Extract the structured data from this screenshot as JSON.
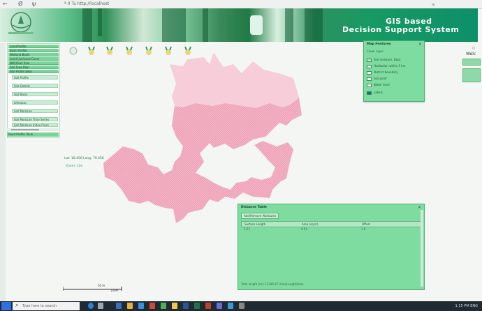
{
  "browser": {
    "url_text": "ª 0 Tu http://localhost",
    "right_text": "ক",
    "nav_back": "←",
    "nav_icons": [
      "Ø",
      "ψ"
    ]
  },
  "header": {
    "title_line1": "GIS based",
    "title_line2": "Decision Support System"
  },
  "sidebar": {
    "items": [
      "Land Profile",
      "Basin Profile",
      "Wetland Basin",
      "Land Use/Land Cover",
      "NDVI/Soil Rain",
      "Soil Type Rain",
      "Soil Profile Sites"
    ],
    "subitems": [
      "Soil Profile",
      "Site Details",
      "Soil Basin",
      "Lithology",
      "Soil Moisture",
      "Soil Moisture Time Series",
      "Soil Moisture Index Class"
    ],
    "bottom_item": "Road Profile Taluk"
  },
  "legend": {
    "title": "Map Features",
    "subtitle": "Cover Layer",
    "rows": [
      {
        "label": "Soil moisture, Dept",
        "color": "#b9e6c6"
      },
      {
        "label": "Habitation within 5 km",
        "color": "#d9f1df"
      },
      {
        "label": "District boundary",
        "color": "#ffffff"
      },
      {
        "label": "Soil point",
        "color": "#eaf7ee"
      },
      {
        "label": "Water level",
        "color": "#ffffff"
      },
      {
        "label": "Labels",
        "color": "#1b6e73"
      }
    ]
  },
  "right": {
    "welcome": "Welc",
    "dot": "○"
  },
  "map": {
    "latlong": "Lat: 18.456 Long: 79.456",
    "zoom": "Zoom: 10x",
    "scale_top": "50 m",
    "scale_bottom": "100m"
  },
  "panel": {
    "title": "Distance Table",
    "button": "Add/Remove Attributes",
    "headers": [
      "Surface Length",
      "Area (sq.m)",
      "Offset"
    ],
    "row": [
      "1.21",
      "0.54",
      "1.0"
    ],
    "footer": "Total length (m): 12345.67 Area/Length/Area"
  },
  "taskbar": {
    "search_placeholder": "Type here to search",
    "tray": "1:15 PM  ENG"
  },
  "colors": {
    "accent": "#79d49a",
    "panel": "#7fdca0",
    "map_fill": "#f3b3c5"
  }
}
